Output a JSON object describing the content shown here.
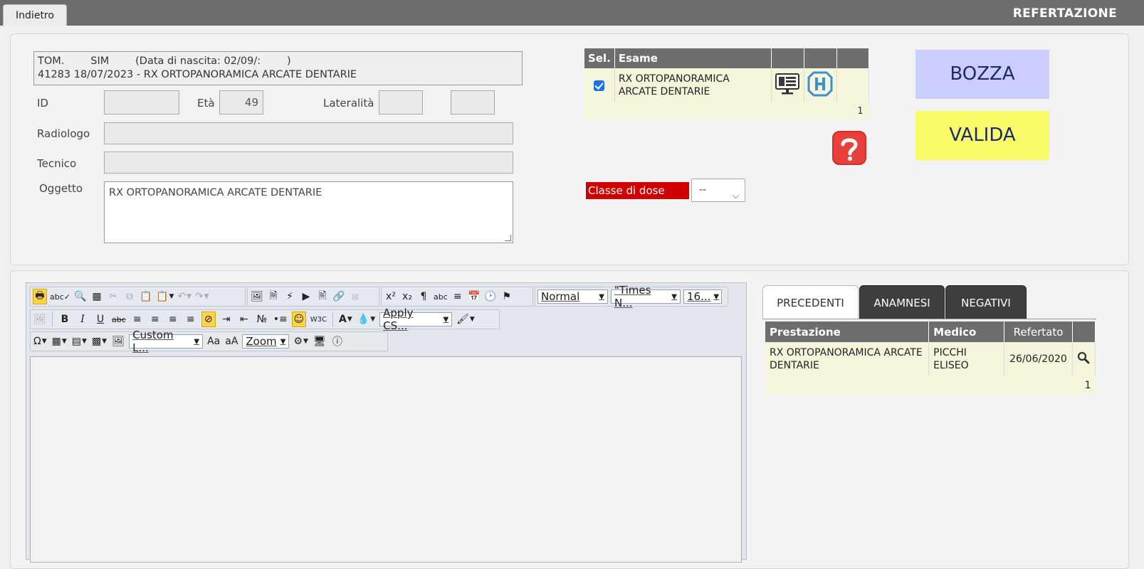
{
  "header": {
    "back_tab": "Indietro",
    "title": "REFERTAZIONE"
  },
  "patient": {
    "line1": "TOM.        SIM        (Data di nascita: 02/09/:        )",
    "line2": "41283 18/07/2023 - RX ORTOPANORAMICA ARCATE DENTARIE"
  },
  "form": {
    "id_label": "ID",
    "id_value": "",
    "age_label": "Età",
    "age_value": "49",
    "laterality_label": "Lateralità",
    "laterality_value": "",
    "extra_value": "",
    "radiologist_label": "Radiologo",
    "radiologist_value": "",
    "technician_label": "Tecnico",
    "technician_value": "",
    "subject_label": "Oggetto",
    "subject_value": "RX ORTOPANORAMICA ARCATE DENTARIE"
  },
  "exams": {
    "headers": [
      "Sel.",
      "Esame",
      "",
      "",
      ""
    ],
    "rows": [
      {
        "selected": true,
        "exam": "RX ORTOPANORAMICA ARCATE DENTARIE"
      }
    ],
    "pager": "1"
  },
  "actions": {
    "draft": "BOZZA",
    "validate": "VALIDA"
  },
  "dose": {
    "label": "Classe di dose",
    "selected": "--"
  },
  "editor": {
    "style_dropdown": "Normal",
    "font_dropdown": "\"Times N...",
    "size_dropdown": "16...",
    "apply_css_dropdown": "Apply CS...",
    "custom_links_dropdown": "Custom L...",
    "zoom_dropdown": "Zoom",
    "content": ""
  },
  "tabs": [
    {
      "label": "PRECEDENTI",
      "active": true
    },
    {
      "label": "ANAMNESI",
      "active": false
    },
    {
      "label": "NEGATIVI",
      "active": false
    }
  ],
  "previous": {
    "headers": [
      "Prestazione",
      "Medico",
      "Refertato",
      ""
    ],
    "rows": [
      {
        "service": "RX ORTOPANORAMICA ARCATE DENTARIE",
        "doctor": "PICCHI ELISEO",
        "date": "26/06/2020"
      }
    ],
    "pager": "1"
  },
  "colors": {
    "topbar": "#6e6d6d",
    "draft_bg": "#cbcdfc",
    "validate_bg": "#fbfc6a",
    "dose_label_bg": "#d00000",
    "row_bg": "#f5f5dc"
  }
}
